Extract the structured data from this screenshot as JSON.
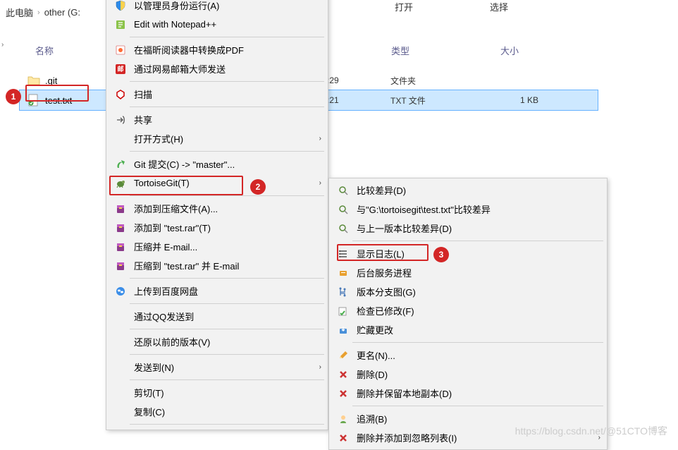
{
  "breadcrumb": {
    "item1": "此电脑",
    "item2": "other (G:"
  },
  "columns": {
    "name": "名称",
    "type": "类型",
    "size": "大小"
  },
  "top_header": {
    "open": "打开",
    "select": "选择"
  },
  "files": [
    {
      "name": ".git",
      "date_end": ":29",
      "type": "文件夹",
      "size": ""
    },
    {
      "name": "test.txt",
      "date_end": ":21",
      "type": "TXT 文件",
      "size": "1 KB"
    }
  ],
  "badges": {
    "b1": "1",
    "b2": "2",
    "b3": "3"
  },
  "menu1": {
    "items": [
      {
        "label": "以管理员身份运行(A)",
        "icon": "shield"
      },
      {
        "label": "Edit with Notepad++",
        "icon": "notepad"
      },
      {
        "label": "在福昕阅读器中转换成PDF",
        "icon": "pdf"
      },
      {
        "label": "通过网易邮箱大师发送",
        "icon": "mail-red"
      },
      {
        "label": "扫描",
        "icon": "mcafee"
      },
      {
        "label": "共享",
        "icon": "share",
        "arrow": false
      },
      {
        "label": "打开方式(H)",
        "icon": "",
        "arrow": true
      },
      {
        "label": "Git 提交(C) -> \"master\"...",
        "icon": "git-commit"
      },
      {
        "label": "TortoiseGit(T)",
        "icon": "tortoise",
        "arrow": true
      },
      {
        "label": "添加到压缩文件(A)...",
        "icon": "rar"
      },
      {
        "label": "添加到 \"test.rar\"(T)",
        "icon": "rar"
      },
      {
        "label": "压缩并 E-mail...",
        "icon": "rar"
      },
      {
        "label": "压缩到 \"test.rar\" 并 E-mail",
        "icon": "rar"
      },
      {
        "label": "上传到百度网盘",
        "icon": "baidu"
      },
      {
        "label": "通过QQ发送到",
        "icon": ""
      },
      {
        "label": "还原以前的版本(V)",
        "icon": ""
      },
      {
        "label": "发送到(N)",
        "icon": "",
        "arrow": true
      },
      {
        "label": "剪切(T)",
        "icon": ""
      },
      {
        "label": "复制(C)",
        "icon": ""
      }
    ]
  },
  "menu2": {
    "items": [
      {
        "label": "比较差异(D)",
        "icon": "magnifier"
      },
      {
        "label": "与\"G:\\tortoisegit\\test.txt\"比较差异",
        "icon": "magnifier"
      },
      {
        "label": "与上一版本比较差异(D)",
        "icon": "magnifier"
      },
      {
        "label": "显示日志(L)",
        "icon": "log"
      },
      {
        "label": "后台服务进程",
        "icon": "daemon"
      },
      {
        "label": "版本分支图(G)",
        "icon": "branch"
      },
      {
        "label": "检查已修改(F)",
        "icon": "check"
      },
      {
        "label": "贮藏更改",
        "icon": "stash"
      },
      {
        "label": "更名(N)...",
        "icon": "rename"
      },
      {
        "label": "删除(D)",
        "icon": "delete"
      },
      {
        "label": "删除并保留本地副本(D)",
        "icon": "delete"
      },
      {
        "label": "追溯(B)",
        "icon": "blame"
      },
      {
        "label": "删除并添加到忽略列表(I)",
        "icon": "delete",
        "arrow": true
      }
    ]
  },
  "watermark": "https://blog.csdn.net/@51CTO博客"
}
